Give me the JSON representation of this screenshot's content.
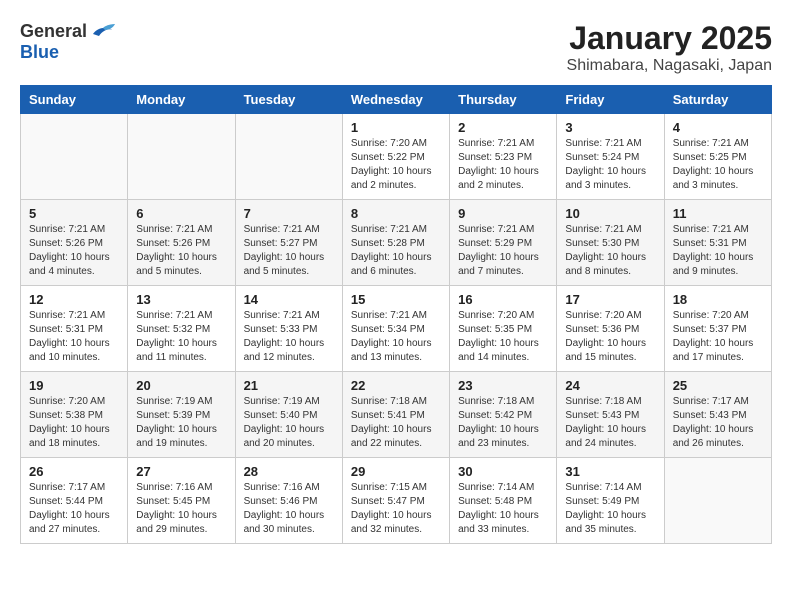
{
  "logo": {
    "general": "General",
    "blue": "Blue"
  },
  "header": {
    "title": "January 2025",
    "subtitle": "Shimabara, Nagasaki, Japan"
  },
  "weekdays": [
    "Sunday",
    "Monday",
    "Tuesday",
    "Wednesday",
    "Thursday",
    "Friday",
    "Saturday"
  ],
  "weeks": [
    [
      {
        "day": "",
        "info": ""
      },
      {
        "day": "",
        "info": ""
      },
      {
        "day": "",
        "info": ""
      },
      {
        "day": "1",
        "info": "Sunrise: 7:20 AM\nSunset: 5:22 PM\nDaylight: 10 hours\nand 2 minutes."
      },
      {
        "day": "2",
        "info": "Sunrise: 7:21 AM\nSunset: 5:23 PM\nDaylight: 10 hours\nand 2 minutes."
      },
      {
        "day": "3",
        "info": "Sunrise: 7:21 AM\nSunset: 5:24 PM\nDaylight: 10 hours\nand 3 minutes."
      },
      {
        "day": "4",
        "info": "Sunrise: 7:21 AM\nSunset: 5:25 PM\nDaylight: 10 hours\nand 3 minutes."
      }
    ],
    [
      {
        "day": "5",
        "info": "Sunrise: 7:21 AM\nSunset: 5:26 PM\nDaylight: 10 hours\nand 4 minutes."
      },
      {
        "day": "6",
        "info": "Sunrise: 7:21 AM\nSunset: 5:26 PM\nDaylight: 10 hours\nand 5 minutes."
      },
      {
        "day": "7",
        "info": "Sunrise: 7:21 AM\nSunset: 5:27 PM\nDaylight: 10 hours\nand 5 minutes."
      },
      {
        "day": "8",
        "info": "Sunrise: 7:21 AM\nSunset: 5:28 PM\nDaylight: 10 hours\nand 6 minutes."
      },
      {
        "day": "9",
        "info": "Sunrise: 7:21 AM\nSunset: 5:29 PM\nDaylight: 10 hours\nand 7 minutes."
      },
      {
        "day": "10",
        "info": "Sunrise: 7:21 AM\nSunset: 5:30 PM\nDaylight: 10 hours\nand 8 minutes."
      },
      {
        "day": "11",
        "info": "Sunrise: 7:21 AM\nSunset: 5:31 PM\nDaylight: 10 hours\nand 9 minutes."
      }
    ],
    [
      {
        "day": "12",
        "info": "Sunrise: 7:21 AM\nSunset: 5:31 PM\nDaylight: 10 hours\nand 10 minutes."
      },
      {
        "day": "13",
        "info": "Sunrise: 7:21 AM\nSunset: 5:32 PM\nDaylight: 10 hours\nand 11 minutes."
      },
      {
        "day": "14",
        "info": "Sunrise: 7:21 AM\nSunset: 5:33 PM\nDaylight: 10 hours\nand 12 minutes."
      },
      {
        "day": "15",
        "info": "Sunrise: 7:21 AM\nSunset: 5:34 PM\nDaylight: 10 hours\nand 13 minutes."
      },
      {
        "day": "16",
        "info": "Sunrise: 7:20 AM\nSunset: 5:35 PM\nDaylight: 10 hours\nand 14 minutes."
      },
      {
        "day": "17",
        "info": "Sunrise: 7:20 AM\nSunset: 5:36 PM\nDaylight: 10 hours\nand 15 minutes."
      },
      {
        "day": "18",
        "info": "Sunrise: 7:20 AM\nSunset: 5:37 PM\nDaylight: 10 hours\nand 17 minutes."
      }
    ],
    [
      {
        "day": "19",
        "info": "Sunrise: 7:20 AM\nSunset: 5:38 PM\nDaylight: 10 hours\nand 18 minutes."
      },
      {
        "day": "20",
        "info": "Sunrise: 7:19 AM\nSunset: 5:39 PM\nDaylight: 10 hours\nand 19 minutes."
      },
      {
        "day": "21",
        "info": "Sunrise: 7:19 AM\nSunset: 5:40 PM\nDaylight: 10 hours\nand 20 minutes."
      },
      {
        "day": "22",
        "info": "Sunrise: 7:18 AM\nSunset: 5:41 PM\nDaylight: 10 hours\nand 22 minutes."
      },
      {
        "day": "23",
        "info": "Sunrise: 7:18 AM\nSunset: 5:42 PM\nDaylight: 10 hours\nand 23 minutes."
      },
      {
        "day": "24",
        "info": "Sunrise: 7:18 AM\nSunset: 5:43 PM\nDaylight: 10 hours\nand 24 minutes."
      },
      {
        "day": "25",
        "info": "Sunrise: 7:17 AM\nSunset: 5:43 PM\nDaylight: 10 hours\nand 26 minutes."
      }
    ],
    [
      {
        "day": "26",
        "info": "Sunrise: 7:17 AM\nSunset: 5:44 PM\nDaylight: 10 hours\nand 27 minutes."
      },
      {
        "day": "27",
        "info": "Sunrise: 7:16 AM\nSunset: 5:45 PM\nDaylight: 10 hours\nand 29 minutes."
      },
      {
        "day": "28",
        "info": "Sunrise: 7:16 AM\nSunset: 5:46 PM\nDaylight: 10 hours\nand 30 minutes."
      },
      {
        "day": "29",
        "info": "Sunrise: 7:15 AM\nSunset: 5:47 PM\nDaylight: 10 hours\nand 32 minutes."
      },
      {
        "day": "30",
        "info": "Sunrise: 7:14 AM\nSunset: 5:48 PM\nDaylight: 10 hours\nand 33 minutes."
      },
      {
        "day": "31",
        "info": "Sunrise: 7:14 AM\nSunset: 5:49 PM\nDaylight: 10 hours\nand 35 minutes."
      },
      {
        "day": "",
        "info": ""
      }
    ]
  ]
}
